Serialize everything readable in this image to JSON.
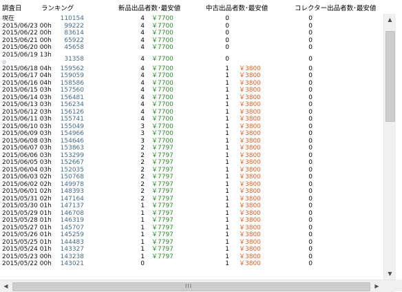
{
  "header": {
    "date": "調査日",
    "ranking": "ランキング",
    "new": "新品出品者数･最安値",
    "used": "中古出品者数･最安値",
    "collector": "コレクター出品者数･最安値"
  },
  "rows": [
    {
      "date": "現在",
      "rank": "110154",
      "new_count": "4",
      "new_price": "￥7700",
      "used_count": "0",
      "used_price": "",
      "col_count": "0"
    },
    {
      "date": "2015/06/23 00h",
      "rank": "99222",
      "new_count": "4",
      "new_price": "￥7700",
      "used_count": "0",
      "used_price": "",
      "col_count": "0"
    },
    {
      "date": "2015/06/22 00h",
      "rank": "83614",
      "new_count": "4",
      "new_price": "￥7700",
      "used_count": "0",
      "used_price": "",
      "col_count": "0"
    },
    {
      "date": "2015/06/21 00h",
      "rank": "65922",
      "new_count": "4",
      "new_price": "￥7700",
      "used_count": "0",
      "used_price": "",
      "col_count": "0"
    },
    {
      "date": "2015/06/20 00h",
      "rank": "45658",
      "new_count": "4",
      "new_price": "￥7700",
      "used_count": "0",
      "used_price": "",
      "col_count": "0"
    },
    {
      "date": "2015/06/19 13h",
      "rank": "31358",
      "new_count": "4",
      "new_price": "￥7700",
      "used_count": "0",
      "used_price": "",
      "col_count": "0",
      "marker": "◎"
    },
    {
      "date": "2015/06/18 04h",
      "rank": "159562",
      "new_count": "4",
      "new_price": "￥7700",
      "used_count": "1",
      "used_price": "￥3800",
      "col_count": "0"
    },
    {
      "date": "2015/06/17 04h",
      "rank": "159059",
      "new_count": "4",
      "new_price": "￥7700",
      "used_count": "1",
      "used_price": "￥3800",
      "col_count": "0"
    },
    {
      "date": "2015/06/16 04h",
      "rank": "158586",
      "new_count": "4",
      "new_price": "￥7700",
      "used_count": "1",
      "used_price": "￥3800",
      "col_count": "0"
    },
    {
      "date": "2015/06/15 03h",
      "rank": "157560",
      "new_count": "4",
      "new_price": "￥7700",
      "used_count": "1",
      "used_price": "￥3800",
      "col_count": "0"
    },
    {
      "date": "2015/06/14 03h",
      "rank": "156481",
      "new_count": "4",
      "new_price": "￥7700",
      "used_count": "1",
      "used_price": "￥3800",
      "col_count": "0"
    },
    {
      "date": "2015/06/13 03h",
      "rank": "156234",
      "new_count": "4",
      "new_price": "￥7700",
      "used_count": "1",
      "used_price": "￥3800",
      "col_count": "0"
    },
    {
      "date": "2015/06/12 03h",
      "rank": "156126",
      "new_count": "4",
      "new_price": "￥7700",
      "used_count": "1",
      "used_price": "￥3800",
      "col_count": "0"
    },
    {
      "date": "2015/06/11 03h",
      "rank": "155741",
      "new_count": "4",
      "new_price": "￥7700",
      "used_count": "1",
      "used_price": "￥3800",
      "col_count": "0"
    },
    {
      "date": "2015/06/10 03h",
      "rank": "155049",
      "new_count": "3",
      "new_price": "￥7700",
      "used_count": "1",
      "used_price": "￥3800",
      "col_count": "0"
    },
    {
      "date": "2015/06/09 03h",
      "rank": "154966",
      "new_count": "3",
      "new_price": "￥7700",
      "used_count": "1",
      "used_price": "￥3800",
      "col_count": "0"
    },
    {
      "date": "2015/06/08 03h",
      "rank": "154646",
      "new_count": "3",
      "new_price": "￥7700",
      "used_count": "1",
      "used_price": "￥3800",
      "col_count": "0"
    },
    {
      "date": "2015/06/07 03h",
      "rank": "153863",
      "new_count": "2",
      "new_price": "￥7797",
      "used_count": "1",
      "used_price": "￥3800",
      "col_count": "0"
    },
    {
      "date": "2015/06/06 03h",
      "rank": "153299",
      "new_count": "2",
      "new_price": "￥7797",
      "used_count": "1",
      "used_price": "￥3800",
      "col_count": "0"
    },
    {
      "date": "2015/06/05 03h",
      "rank": "152667",
      "new_count": "2",
      "new_price": "￥7797",
      "used_count": "1",
      "used_price": "￥3800",
      "col_count": "0"
    },
    {
      "date": "2015/06/04 03h",
      "rank": "152035",
      "new_count": "2",
      "new_price": "￥7797",
      "used_count": "1",
      "used_price": "￥3800",
      "col_count": "0"
    },
    {
      "date": "2015/06/03 02h",
      "rank": "150768",
      "new_count": "2",
      "new_price": "￥7797",
      "used_count": "1",
      "used_price": "￥3800",
      "col_count": "0"
    },
    {
      "date": "2015/06/02 02h",
      "rank": "149978",
      "new_count": "2",
      "new_price": "￥7797",
      "used_count": "1",
      "used_price": "￥3800",
      "col_count": "0"
    },
    {
      "date": "2015/06/01 02h",
      "rank": "148393",
      "new_count": "2",
      "new_price": "￥7797",
      "used_count": "1",
      "used_price": "￥3800",
      "col_count": "0"
    },
    {
      "date": "2015/05/31 02h",
      "rank": "147164",
      "new_count": "2",
      "new_price": "￥7797",
      "used_count": "1",
      "used_price": "￥3800",
      "col_count": "0"
    },
    {
      "date": "2015/05/30 01h",
      "rank": "147137",
      "new_count": "1",
      "new_price": "￥7797",
      "used_count": "1",
      "used_price": "￥3800",
      "col_count": "0"
    },
    {
      "date": "2015/05/29 01h",
      "rank": "146708",
      "new_count": "1",
      "new_price": "￥7797",
      "used_count": "1",
      "used_price": "￥3800",
      "col_count": "0"
    },
    {
      "date": "2015/05/28 01h",
      "rank": "146319",
      "new_count": "1",
      "new_price": "￥7797",
      "used_count": "1",
      "used_price": "￥3800",
      "col_count": "0"
    },
    {
      "date": "2015/05/27 01h",
      "rank": "145707",
      "new_count": "1",
      "new_price": "￥7797",
      "used_count": "1",
      "used_price": "￥3800",
      "col_count": "0"
    },
    {
      "date": "2015/05/26 01h",
      "rank": "145259",
      "new_count": "1",
      "new_price": "￥7797",
      "used_count": "1",
      "used_price": "￥3800",
      "col_count": "0"
    },
    {
      "date": "2015/05/25 01h",
      "rank": "144483",
      "new_count": "1",
      "new_price": "￥7797",
      "used_count": "1",
      "used_price": "￥3800",
      "col_count": "0"
    },
    {
      "date": "2015/05/24 01h",
      "rank": "143327",
      "new_count": "1",
      "new_price": "￥7797",
      "used_count": "1",
      "used_price": "￥3800",
      "col_count": "0"
    },
    {
      "date": "2015/05/23 00h",
      "rank": "143238",
      "new_count": "1",
      "new_price": "￥7797",
      "used_count": "1",
      "used_price": "￥3800",
      "col_count": "0"
    },
    {
      "date": "2015/05/22 00h",
      "rank": "143021",
      "new_count": "0",
      "new_price": "",
      "used_count": "1",
      "used_price": "￥3800",
      "col_count": "0"
    }
  ],
  "scrollbar": {
    "up": "▲",
    "down": "▼",
    "left": "◀",
    "right": "▶",
    "grip": "III"
  },
  "colors": {
    "rank": "#446b8a",
    "new_price": "#2a8a2a",
    "used_price": "#e06020"
  }
}
